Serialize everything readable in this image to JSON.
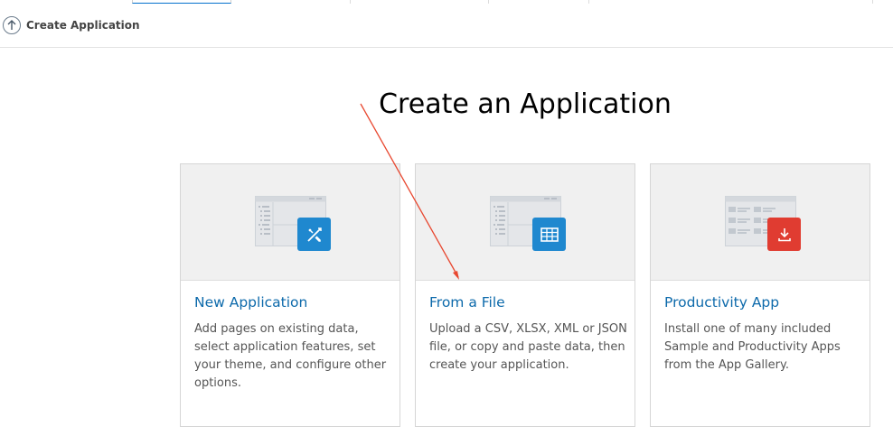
{
  "header": {
    "title": "Create Application",
    "back_icon": "arrow-up-circle-icon"
  },
  "page": {
    "title": "Create an Application"
  },
  "cards": [
    {
      "title": "New Application",
      "description": "Add pages on existing data, select application features, set your theme, and configure other options.",
      "icon": "design-tools-icon",
      "badge_color": "#1f88cf"
    },
    {
      "title": "From a File",
      "description": "Upload a CSV, XLSX, XML or JSON file, or copy and paste data, then create your application.",
      "icon": "table-grid-icon",
      "badge_color": "#1f88cf"
    },
    {
      "title": "Productivity App",
      "description": "Install one of many included Sample and Productivity Apps from the App Gallery.",
      "icon": "download-icon",
      "badge_color": "#e03c31"
    }
  ],
  "colors": {
    "link": "#0d6aab",
    "annotation_arrow": "#e8472f"
  }
}
